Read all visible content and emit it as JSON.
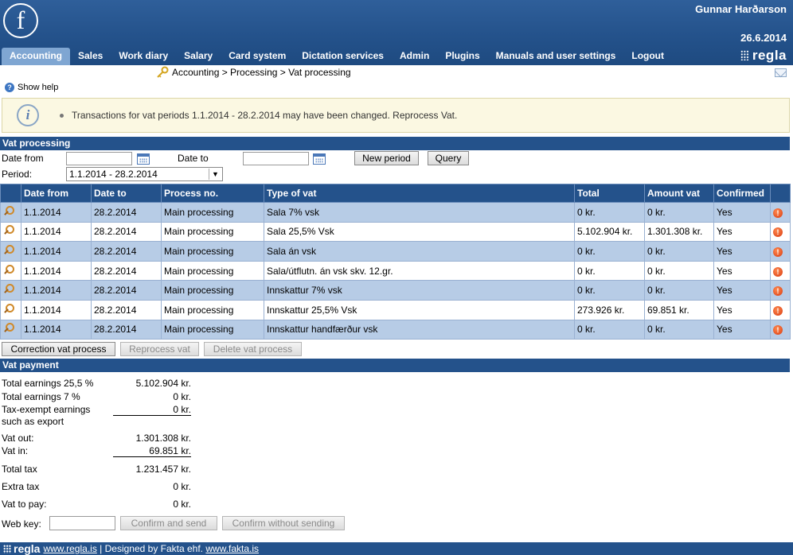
{
  "header": {
    "user_name": "Gunnar Harðarson",
    "date": "26.6.2014",
    "brand": "regla",
    "logo_letter": "f",
    "nav": [
      "Accounting",
      "Sales",
      "Work diary",
      "Salary",
      "Card system",
      "Dictation services",
      "Admin",
      "Plugins",
      "Manuals and user settings",
      "Logout"
    ]
  },
  "breadcrumb": "Accounting > Processing > Vat processing",
  "help": "Show help",
  "info": {
    "icon_letter": "i",
    "message": "Transactions for vat periods 1.1.2014 - 28.2.2014 may have been changed. Reprocess Vat."
  },
  "vat_processing": {
    "title": "Vat processing",
    "date_from_label": "Date from",
    "date_to_label": "Date to",
    "date_from_value": "",
    "date_to_value": "",
    "new_period_button": "New period",
    "query_button": "Query",
    "period_label": "Period:",
    "period_value": "1.1.2014 - 28.2.2014",
    "columns": [
      "Date from",
      "Date to",
      "Process no.",
      "Type of vat",
      "Total",
      "Amount vat",
      "Confirmed"
    ],
    "rows": [
      {
        "date_from": "1.1.2014",
        "date_to": "28.2.2014",
        "process": "Main processing",
        "type": "Sala 7% vsk",
        "total": "0 kr.",
        "vat": "0 kr.",
        "confirmed": "Yes"
      },
      {
        "date_from": "1.1.2014",
        "date_to": "28.2.2014",
        "process": "Main processing",
        "type": "Sala 25,5% Vsk",
        "total": "5.102.904 kr.",
        "vat": "1.301.308 kr.",
        "confirmed": "Yes"
      },
      {
        "date_from": "1.1.2014",
        "date_to": "28.2.2014",
        "process": "Main processing",
        "type": "Sala án vsk",
        "total": "0 kr.",
        "vat": "0 kr.",
        "confirmed": "Yes"
      },
      {
        "date_from": "1.1.2014",
        "date_to": "28.2.2014",
        "process": "Main processing",
        "type": "Sala/útflutn. án vsk skv. 12.gr.",
        "total": "0 kr.",
        "vat": "0 kr.",
        "confirmed": "Yes"
      },
      {
        "date_from": "1.1.2014",
        "date_to": "28.2.2014",
        "process": "Main processing",
        "type": "Innskattur 7% vsk",
        "total": "0 kr.",
        "vat": "0 kr.",
        "confirmed": "Yes"
      },
      {
        "date_from": "1.1.2014",
        "date_to": "28.2.2014",
        "process": "Main processing",
        "type": "Innskattur 25,5% Vsk",
        "total": "273.926 kr.",
        "vat": "69.851 kr.",
        "confirmed": "Yes"
      },
      {
        "date_from": "1.1.2014",
        "date_to": "28.2.2014",
        "process": "Main processing",
        "type": "Innskattur handfærður vsk",
        "total": "0 kr.",
        "vat": "0 kr.",
        "confirmed": "Yes"
      }
    ],
    "correction_button": "Correction vat process",
    "reprocess_button": "Reprocess vat",
    "delete_button": "Delete vat process"
  },
  "vat_payment": {
    "title": "Vat payment",
    "earnings_25_label": "Total earnings 25,5 %",
    "earnings_25_value": "5.102.904 kr.",
    "earnings_7_label": "Total earnings 7 %",
    "earnings_7_value": "0 kr.",
    "exempt_label_1": "Tax-exempt earnings",
    "exempt_label_2": "such as export",
    "exempt_value": "0 kr.",
    "vat_out_label": "Vat out:",
    "vat_out_value": "1.301.308 kr.",
    "vat_in_label": "Vat in:",
    "vat_in_value": "69.851 kr.",
    "total_tax_label": "Total tax",
    "total_tax_value": "1.231.457 kr.",
    "extra_tax_label": "Extra tax",
    "extra_tax_value": "0 kr.",
    "vat_to_pay_label": "Vat to pay:",
    "vat_to_pay_value": "0 kr.",
    "web_key_label": "Web key:",
    "web_key_value": "",
    "confirm_send_button": "Confirm and send",
    "confirm_no_send_button": "Confirm without sending"
  },
  "footer": {
    "brand": "regla",
    "link1": "www.regla.is",
    "separator": " | Designed by Fakta ehf. ",
    "link2": "www.fakta.is"
  }
}
